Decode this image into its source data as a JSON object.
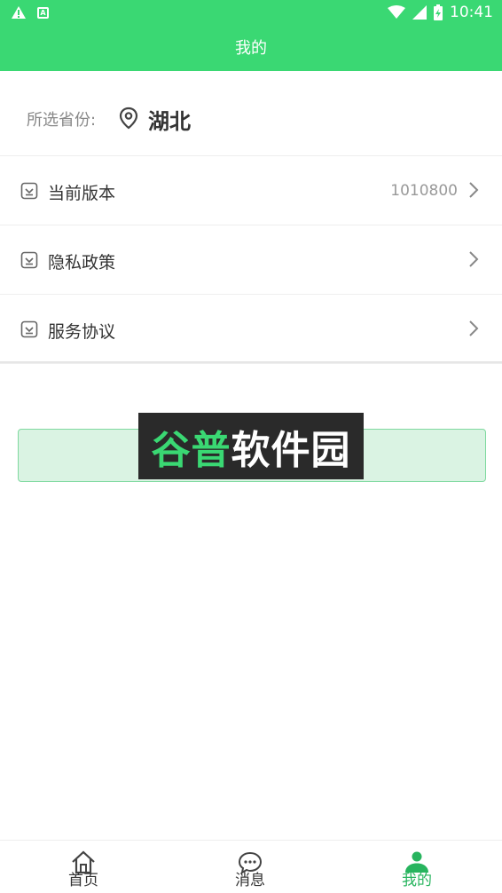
{
  "status_bar": {
    "time": "10:41"
  },
  "header": {
    "title": "我的"
  },
  "province": {
    "label": "所选省份:",
    "value": "湖北"
  },
  "menu": [
    {
      "label": "当前版本",
      "value": "1010800"
    },
    {
      "label": "隐私政策",
      "value": ""
    },
    {
      "label": "服务协议",
      "value": ""
    }
  ],
  "watermark": {
    "part1": "谷普",
    "part2": "软件园"
  },
  "tabs": [
    {
      "label": "首页",
      "icon": "home-icon"
    },
    {
      "label": "消息",
      "icon": "message-icon"
    },
    {
      "label": "我的",
      "icon": "profile-icon"
    }
  ],
  "colors": {
    "brand": "#3ad873",
    "active_tab": "#27b45e",
    "button_bg": "#daf3e3"
  }
}
